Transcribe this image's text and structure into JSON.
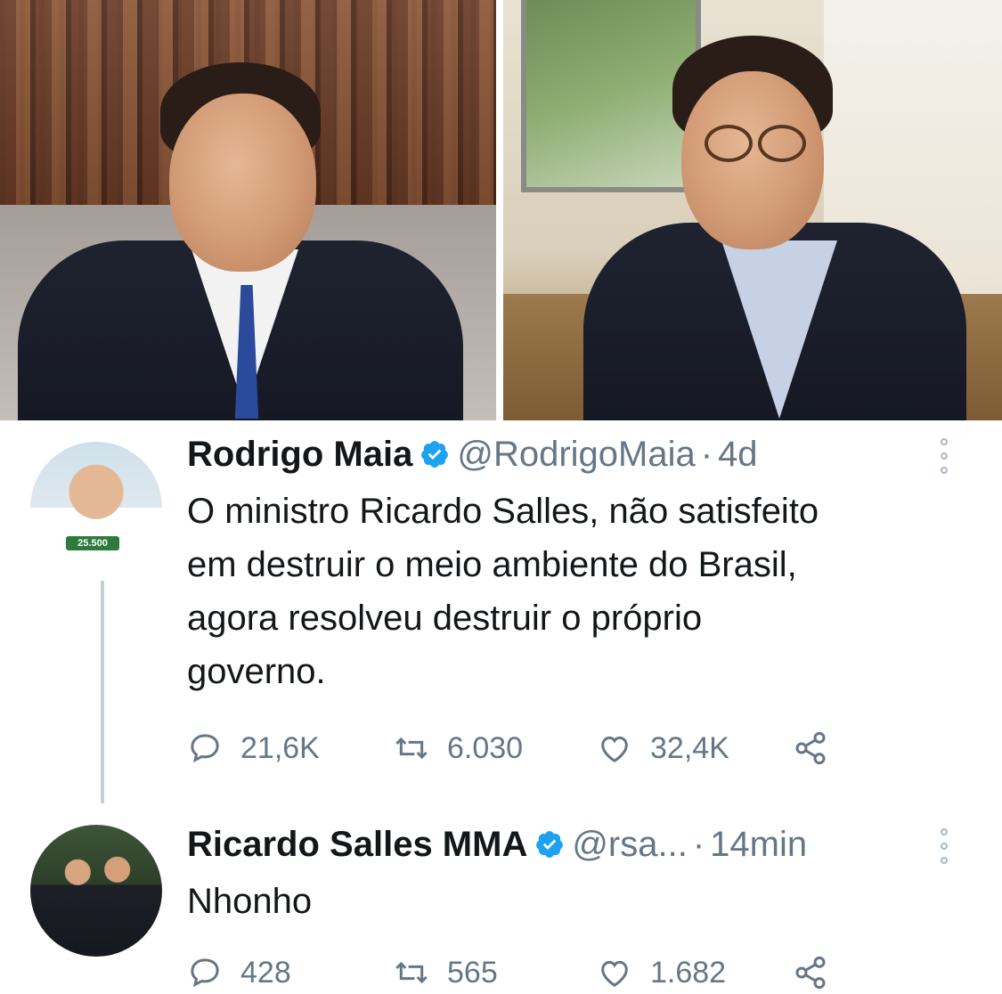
{
  "photos": {
    "left_alt": "",
    "right_alt": ""
  },
  "tweets": [
    {
      "display_name": "Rodrigo Maia",
      "handle": "@RodrigoMaia",
      "separator": "·",
      "time": "4d",
      "text": "O ministro Ricardo Salles, não satisfeito\nem destruir o meio ambiente do Brasil,\nagora resolveu destruir o próprio\ngoverno.",
      "avatar_badge": "25.500",
      "replies": "21,6K",
      "retweets": "6.030",
      "likes": "32,4K",
      "verified": true
    },
    {
      "display_name": "Ricardo Salles MMA",
      "handle": "@rsa...",
      "separator": "·",
      "time": "14min",
      "text": "Nhonho",
      "replies": "428",
      "retweets": "565",
      "likes": "1.682",
      "verified": true
    }
  ],
  "icons": {
    "verified": "verified-check-icon",
    "reply": "speech-bubble-icon",
    "retweet": "retweet-arrows-icon",
    "like": "heart-icon",
    "share": "share-icon",
    "menu": "vertical-dots-icon"
  },
  "colors": {
    "verified_blue": "#1da1f2",
    "secondary_text": "#657786",
    "primary_text": "#14171a",
    "thread_line": "#c7cfd6"
  }
}
